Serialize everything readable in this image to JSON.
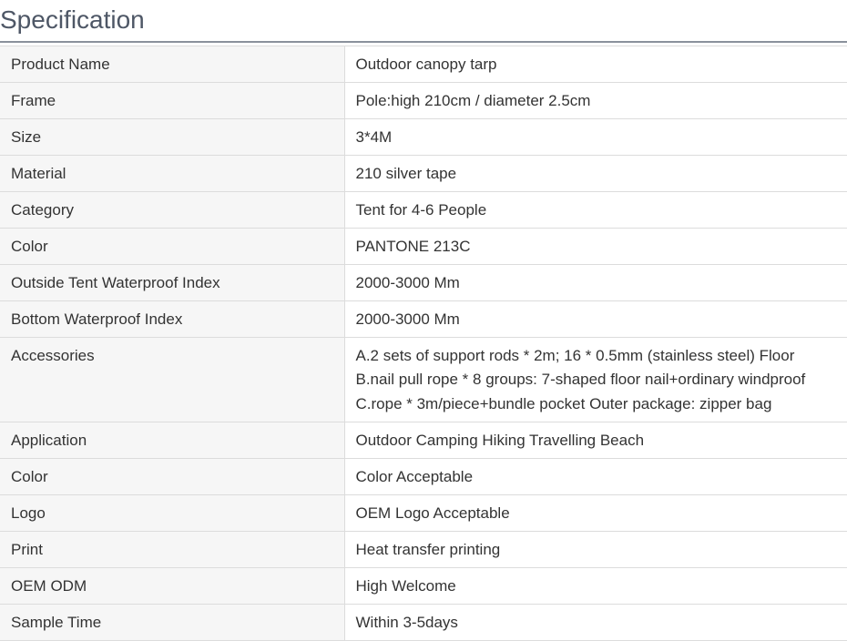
{
  "heading": "Specification",
  "rows": [
    {
      "key": "Product Name",
      "value": [
        "Outdoor canopy tarp"
      ]
    },
    {
      "key": "Frame",
      "value": [
        "Pole:high 210cm / diameter 2.5cm"
      ]
    },
    {
      "key": "Size",
      "value": [
        "3*4M"
      ]
    },
    {
      "key": "Material",
      "value": [
        "210 silver tape"
      ]
    },
    {
      "key": "Category",
      "value": [
        "Tent for 4-6 People"
      ]
    },
    {
      "key": "Color",
      "value": [
        "PANTONE 213C"
      ]
    },
    {
      "key": "Outside Tent Waterproof Index",
      "value": [
        "2000-3000 Mm"
      ]
    },
    {
      "key": "Bottom Waterproof Index",
      "value": [
        "2000-3000 Mm"
      ]
    },
    {
      "key": "Accessories",
      "value": [
        "A.2 sets of support rods * 2m; 16 * 0.5mm (stainless steel) Floor",
        "B.nail pull rope * 8 groups: 7-shaped floor nail+ordinary windproof",
        "C.rope * 3m/piece+bundle pocket Outer package: zipper bag"
      ]
    },
    {
      "key": "Application",
      "value": [
        "Outdoor Camping Hiking Travelling Beach"
      ]
    },
    {
      "key": "Color",
      "value": [
        "Color Acceptable"
      ]
    },
    {
      "key": "Logo",
      "value": [
        "OEM Logo Acceptable"
      ]
    },
    {
      "key": "Print",
      "value": [
        "Heat transfer printing"
      ]
    },
    {
      "key": "OEM ODM",
      "value": [
        "High Welcome"
      ]
    },
    {
      "key": "Sample Time",
      "value": [
        "Within 3-5days"
      ]
    }
  ]
}
